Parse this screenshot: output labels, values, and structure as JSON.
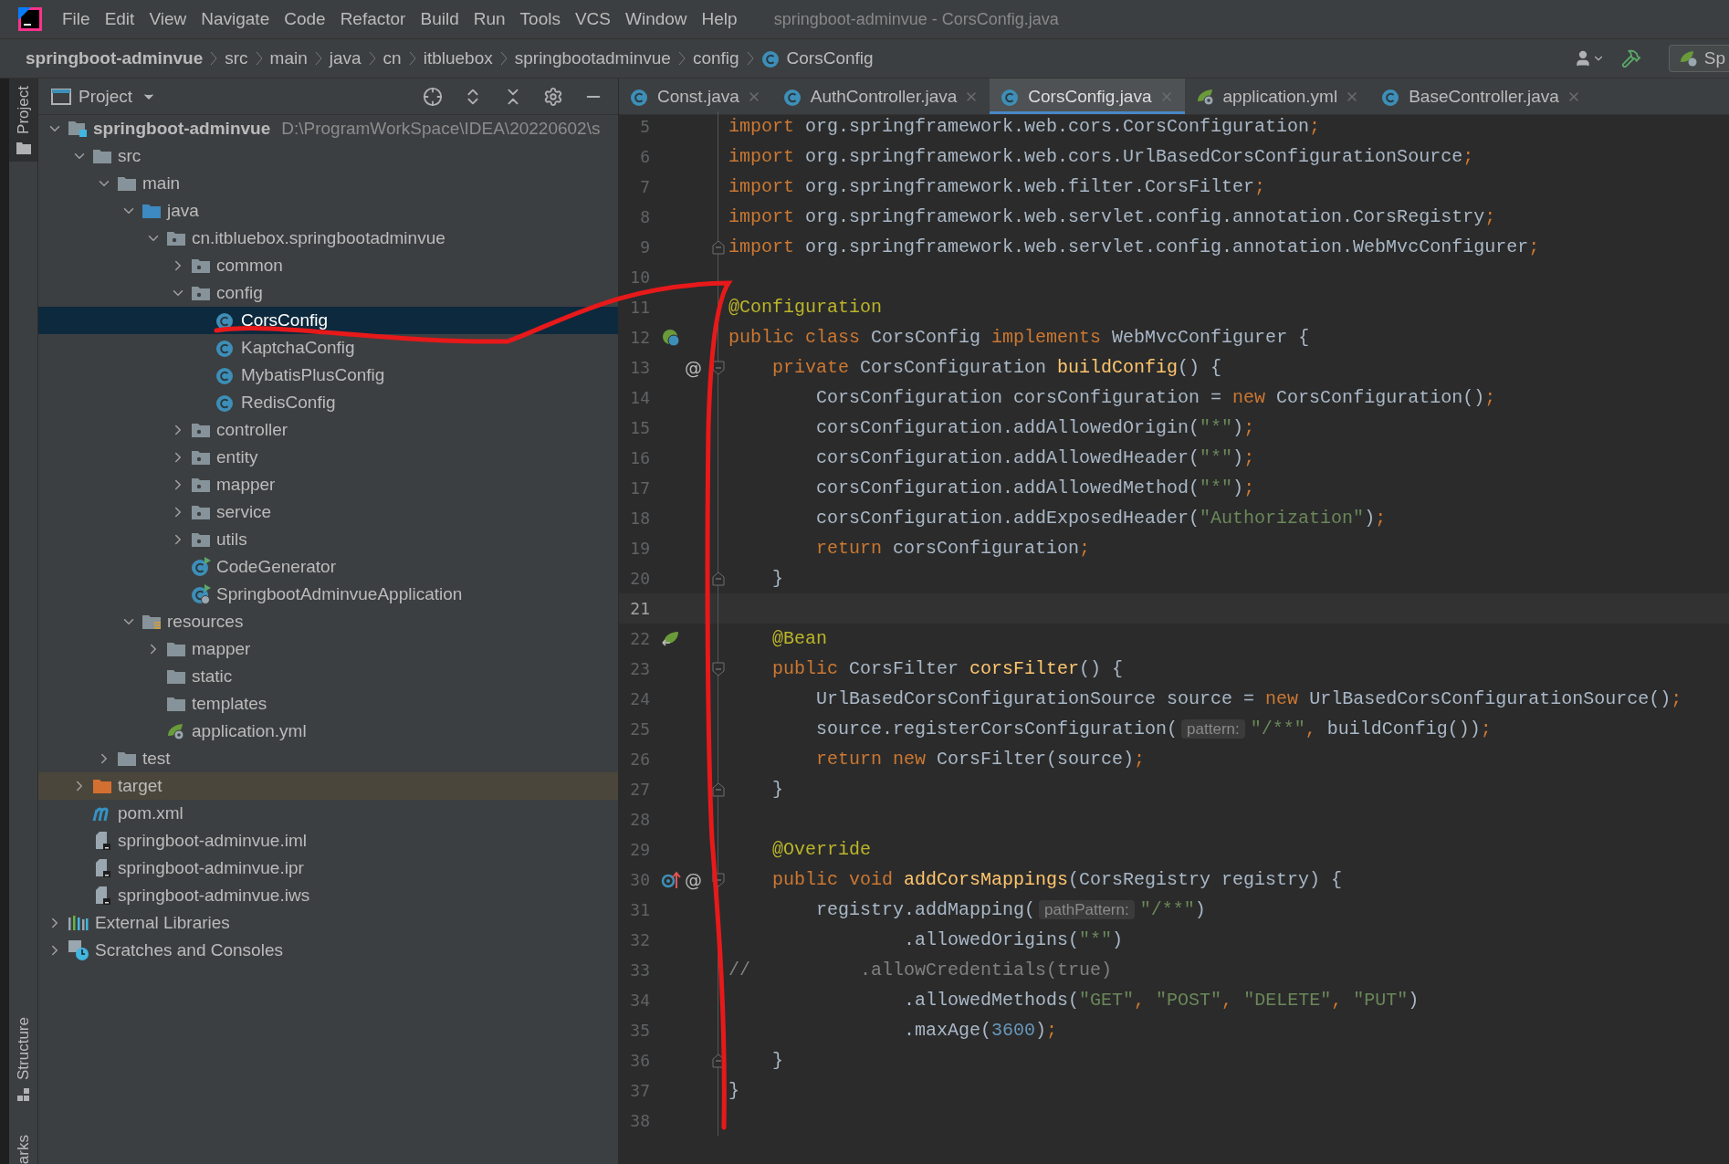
{
  "menu_bar": {
    "items": [
      "File",
      "Edit",
      "View",
      "Navigate",
      "Code",
      "Refactor",
      "Build",
      "Run",
      "Tools",
      "VCS",
      "Window",
      "Help"
    ],
    "title": "springboot-adminvue - CorsConfig.java"
  },
  "breadcrumb": [
    {
      "label": "springboot-adminvue",
      "kind": "project"
    },
    {
      "label": "src",
      "kind": "folder"
    },
    {
      "label": "main",
      "kind": "folder"
    },
    {
      "label": "java",
      "kind": "folder"
    },
    {
      "label": "cn",
      "kind": "folder"
    },
    {
      "label": "itbluebox",
      "kind": "folder"
    },
    {
      "label": "springbootadminvue",
      "kind": "folder"
    },
    {
      "label": "config",
      "kind": "folder"
    },
    {
      "label": "CorsConfig",
      "kind": "class"
    }
  ],
  "run_config": {
    "label": "Sp"
  },
  "side_stripe": {
    "top": "Project",
    "bottom": "Structure",
    "cut": "arks"
  },
  "project_panel": {
    "title": "Project",
    "tree": [
      {
        "label": "springboot-adminvue",
        "path": "D:\\ProgramWorkSpace\\IDEA\\20220602\\s",
        "kind": "module",
        "expanded": true,
        "selected": false,
        "children": [
          {
            "label": "src",
            "kind": "folder",
            "expanded": true,
            "selected": false,
            "children": [
              {
                "label": "main",
                "kind": "folder",
                "expanded": true,
                "selected": false,
                "children": [
                  {
                    "label": "java",
                    "kind": "source",
                    "expanded": true,
                    "selected": false,
                    "children": [
                      {
                        "label": "cn.itbluebox.springbootadminvue",
                        "kind": "package",
                        "expanded": true,
                        "selected": false,
                        "children": [
                          {
                            "label": "common",
                            "kind": "package",
                            "expanded": false,
                            "selected": false
                          },
                          {
                            "label": "config",
                            "kind": "package",
                            "expanded": true,
                            "selected": false,
                            "children": [
                              {
                                "label": "CorsConfig",
                                "kind": "class",
                                "selected": true
                              },
                              {
                                "label": "KaptchaConfig",
                                "kind": "class",
                                "selected": false
                              },
                              {
                                "label": "MybatisPlusConfig",
                                "kind": "class",
                                "selected": false
                              },
                              {
                                "label": "RedisConfig",
                                "kind": "class",
                                "selected": false
                              }
                            ]
                          },
                          {
                            "label": "controller",
                            "kind": "package",
                            "expanded": false,
                            "selected": false
                          },
                          {
                            "label": "entity",
                            "kind": "package",
                            "expanded": false,
                            "selected": false
                          },
                          {
                            "label": "mapper",
                            "kind": "package",
                            "expanded": false,
                            "selected": false
                          },
                          {
                            "label": "service",
                            "kind": "package",
                            "expanded": false,
                            "selected": false
                          },
                          {
                            "label": "utils",
                            "kind": "package",
                            "expanded": false,
                            "selected": false
                          },
                          {
                            "label": "CodeGenerator",
                            "kind": "runnable",
                            "selected": false
                          },
                          {
                            "label": "SpringbootAdminvueApplication",
                            "kind": "spring-app",
                            "selected": false
                          }
                        ]
                      }
                    ]
                  },
                  {
                    "label": "resources",
                    "kind": "resources",
                    "expanded": true,
                    "selected": false,
                    "children": [
                      {
                        "label": "mapper",
                        "kind": "folder",
                        "expanded": false,
                        "selected": false
                      },
                      {
                        "label": "static",
                        "kind": "folder",
                        "selected": false
                      },
                      {
                        "label": "templates",
                        "kind": "folder",
                        "selected": false
                      },
                      {
                        "label": "application.yml",
                        "kind": "yml",
                        "selected": false
                      }
                    ]
                  }
                ]
              },
              {
                "label": "test",
                "kind": "folder",
                "expanded": false,
                "selected": false
              }
            ]
          },
          {
            "label": "target",
            "kind": "excluded",
            "expanded": false,
            "selected": false
          },
          {
            "label": "pom.xml",
            "kind": "maven",
            "selected": false
          },
          {
            "label": "springboot-adminvue.iml",
            "kind": "module-file",
            "selected": false
          },
          {
            "label": "springboot-adminvue.ipr",
            "kind": "module-file",
            "selected": false
          },
          {
            "label": "springboot-adminvue.iws",
            "kind": "module-file",
            "selected": false
          }
        ]
      },
      {
        "label": "External Libraries",
        "kind": "libraries",
        "expanded": false,
        "selected": false
      },
      {
        "label": "Scratches and Consoles",
        "kind": "scratches",
        "expanded": false,
        "selected": false
      }
    ]
  },
  "tabs": [
    {
      "label": "Const.java",
      "kind": "class",
      "selected": false
    },
    {
      "label": "AuthController.java",
      "kind": "class",
      "selected": false
    },
    {
      "label": "CorsConfig.java",
      "kind": "class",
      "selected": true
    },
    {
      "label": "application.yml",
      "kind": "yml",
      "selected": false
    },
    {
      "label": "BaseController.java",
      "kind": "class",
      "selected": false
    }
  ],
  "code": [
    {
      "number": "5",
      "current": false,
      "tokens": [
        {
          "kind": "kw",
          "text": "import"
        },
        {
          "kind": "plain",
          "text": " org.springframework.web.cors.CorsConfiguration"
        },
        {
          "kind": "kw",
          "text": ";"
        }
      ]
    },
    {
      "number": "6",
      "current": false,
      "tokens": [
        {
          "kind": "kw",
          "text": "import"
        },
        {
          "kind": "plain",
          "text": " org.springframework.web.cors.UrlBasedCorsConfigurationSource"
        },
        {
          "kind": "kw",
          "text": ";"
        }
      ]
    },
    {
      "number": "7",
      "current": false,
      "tokens": [
        {
          "kind": "kw",
          "text": "import"
        },
        {
          "kind": "plain",
          "text": " org.springframework.web.filter.CorsFilter"
        },
        {
          "kind": "kw",
          "text": ";"
        }
      ]
    },
    {
      "number": "8",
      "current": false,
      "tokens": [
        {
          "kind": "kw",
          "text": "import"
        },
        {
          "kind": "plain",
          "text": " org.springframework.web.servlet.config.annotation.CorsRegistry"
        },
        {
          "kind": "kw",
          "text": ";"
        }
      ]
    },
    {
      "number": "9",
      "current": false,
      "tokens": [
        {
          "kind": "kw",
          "text": "import"
        },
        {
          "kind": "plain",
          "text": " org.springframework.web.servlet.config.annotation.WebMvcConfigurer"
        },
        {
          "kind": "kw",
          "text": ";"
        }
      ]
    },
    {
      "number": "10",
      "current": false
    },
    {
      "number": "11",
      "current": false,
      "tokens": [
        {
          "kind": "ann",
          "text": "@Configuration"
        }
      ]
    },
    {
      "number": "12",
      "current": false,
      "tokens": [
        {
          "kind": "kw",
          "text": "public class"
        },
        {
          "kind": "plain",
          "text": " CorsConfig "
        },
        {
          "kind": "kw",
          "text": "implements"
        },
        {
          "kind": "plain",
          "text": " WebMvcConfigurer {"
        }
      ]
    },
    {
      "number": "13",
      "current": false,
      "gutter_mark": "@",
      "tokens": [
        {
          "kind": "kw",
          "text": "    private"
        },
        {
          "kind": "plain",
          "text": " CorsConfiguration "
        },
        {
          "kind": "method",
          "text": "buildConfig"
        },
        {
          "kind": "plain",
          "text": "() {"
        }
      ]
    },
    {
      "number": "14",
      "current": false,
      "tokens": [
        {
          "kind": "plain",
          "text": "        CorsConfiguration corsConfiguration = "
        },
        {
          "kind": "kw",
          "text": "new"
        },
        {
          "kind": "plain",
          "text": " CorsConfiguration()"
        },
        {
          "kind": "kw",
          "text": ";"
        }
      ]
    },
    {
      "number": "15",
      "current": false,
      "tokens": [
        {
          "kind": "plain",
          "text": "        corsConfiguration.addAllowedOrigin("
        },
        {
          "kind": "str",
          "text": "\"*\""
        },
        {
          "kind": "plain",
          "text": ")"
        },
        {
          "kind": "kw",
          "text": ";"
        }
      ]
    },
    {
      "number": "16",
      "current": false,
      "tokens": [
        {
          "kind": "plain",
          "text": "        corsConfiguration.addAllowedHeader("
        },
        {
          "kind": "str",
          "text": "\"*\""
        },
        {
          "kind": "plain",
          "text": ")"
        },
        {
          "kind": "kw",
          "text": ";"
        }
      ]
    },
    {
      "number": "17",
      "current": false,
      "tokens": [
        {
          "kind": "plain",
          "text": "        corsConfiguration.addAllowedMethod("
        },
        {
          "kind": "str",
          "text": "\"*\""
        },
        {
          "kind": "plain",
          "text": ")"
        },
        {
          "kind": "kw",
          "text": ";"
        }
      ]
    },
    {
      "number": "18",
      "current": false,
      "tokens": [
        {
          "kind": "plain",
          "text": "        corsConfiguration.addExposedHeader("
        },
        {
          "kind": "str",
          "text": "\"Authorization\""
        },
        {
          "kind": "plain",
          "text": ")"
        },
        {
          "kind": "kw",
          "text": ";"
        }
      ]
    },
    {
      "number": "19",
      "current": false,
      "tokens": [
        {
          "kind": "kw",
          "text": "        return"
        },
        {
          "kind": "plain",
          "text": " corsConfiguration"
        },
        {
          "kind": "kw",
          "text": ";"
        }
      ]
    },
    {
      "number": "20",
      "current": false,
      "tokens": [
        {
          "kind": "plain",
          "text": "    }"
        }
      ]
    },
    {
      "number": "21",
      "current": true
    },
    {
      "number": "22",
      "current": false,
      "tokens": [
        {
          "kind": "ann",
          "text": "    @Bean"
        }
      ]
    },
    {
      "number": "23",
      "current": false,
      "tokens": [
        {
          "kind": "kw",
          "text": "    public"
        },
        {
          "kind": "plain",
          "text": " CorsFilter "
        },
        {
          "kind": "method",
          "text": "corsFilter"
        },
        {
          "kind": "plain",
          "text": "() {"
        }
      ]
    },
    {
      "number": "24",
      "current": false,
      "tokens": [
        {
          "kind": "plain",
          "text": "        UrlBasedCorsConfigurationSource source = "
        },
        {
          "kind": "kw",
          "text": "new"
        },
        {
          "kind": "plain",
          "text": " UrlBasedCorsConfigurationSource()"
        },
        {
          "kind": "kw",
          "text": ";"
        }
      ]
    },
    {
      "number": "25",
      "current": false,
      "tokens": [
        {
          "kind": "plain",
          "text": "        source.registerCorsConfiguration("
        },
        {
          "kind": "hint",
          "text": "pattern:"
        },
        {
          "kind": "str",
          "text": "\"/**\""
        },
        {
          "kind": "kw",
          "text": ","
        },
        {
          "kind": "plain",
          "text": " buildConfig())"
        },
        {
          "kind": "kw",
          "text": ";"
        }
      ]
    },
    {
      "number": "26",
      "current": false,
      "tokens": [
        {
          "kind": "kw",
          "text": "        return new"
        },
        {
          "kind": "plain",
          "text": " CorsFilter(source)"
        },
        {
          "kind": "kw",
          "text": ";"
        }
      ]
    },
    {
      "number": "27",
      "current": false,
      "tokens": [
        {
          "kind": "plain",
          "text": "    }"
        }
      ]
    },
    {
      "number": "28",
      "current": false
    },
    {
      "number": "29",
      "current": false,
      "tokens": [
        {
          "kind": "ann",
          "text": "    @Override"
        }
      ]
    },
    {
      "number": "30",
      "current": false,
      "gutter_mark": "@",
      "tokens": [
        {
          "kind": "kw",
          "text": "    public void "
        },
        {
          "kind": "method",
          "text": "addCorsMappings"
        },
        {
          "kind": "plain",
          "text": "(CorsRegistry registry) {"
        }
      ]
    },
    {
      "number": "31",
      "current": false,
      "tokens": [
        {
          "kind": "plain",
          "text": "        registry.addMapping("
        },
        {
          "kind": "hint",
          "text": "pathPattern:"
        },
        {
          "kind": "str",
          "text": "\"/**\""
        },
        {
          "kind": "plain",
          "text": ")"
        }
      ]
    },
    {
      "number": "32",
      "current": false,
      "tokens": [
        {
          "kind": "plain",
          "text": "                .allowedOrigins("
        },
        {
          "kind": "str",
          "text": "\"*\""
        },
        {
          "kind": "plain",
          "text": ")"
        }
      ]
    },
    {
      "number": "33",
      "current": false,
      "tokens": [
        {
          "kind": "comment",
          "text": "//          .allowCredentials(true)"
        }
      ]
    },
    {
      "number": "34",
      "current": false,
      "tokens": [
        {
          "kind": "plain",
          "text": "                .allowedMethods("
        },
        {
          "kind": "str",
          "text": "\"GET\""
        },
        {
          "kind": "kw",
          "text": ", "
        },
        {
          "kind": "str",
          "text": "\"POST\""
        },
        {
          "kind": "kw",
          "text": ", "
        },
        {
          "kind": "str",
          "text": "\"DELETE\""
        },
        {
          "kind": "kw",
          "text": ", "
        },
        {
          "kind": "str",
          "text": "\"PUT\""
        },
        {
          "kind": "plain",
          "text": ")"
        }
      ]
    },
    {
      "number": "35",
      "current": false,
      "tokens": [
        {
          "kind": "plain",
          "text": "                .maxAge("
        },
        {
          "kind": "num",
          "text": "3600"
        },
        {
          "kind": "plain",
          "text": ")"
        },
        {
          "kind": "kw",
          "text": ";"
        }
      ]
    },
    {
      "number": "36",
      "current": false,
      "tokens": [
        {
          "kind": "plain",
          "text": "    }"
        }
      ]
    },
    {
      "number": "37",
      "current": false,
      "tokens": [
        {
          "kind": "plain",
          "text": "}"
        }
      ]
    },
    {
      "number": "38",
      "current": false
    }
  ]
}
